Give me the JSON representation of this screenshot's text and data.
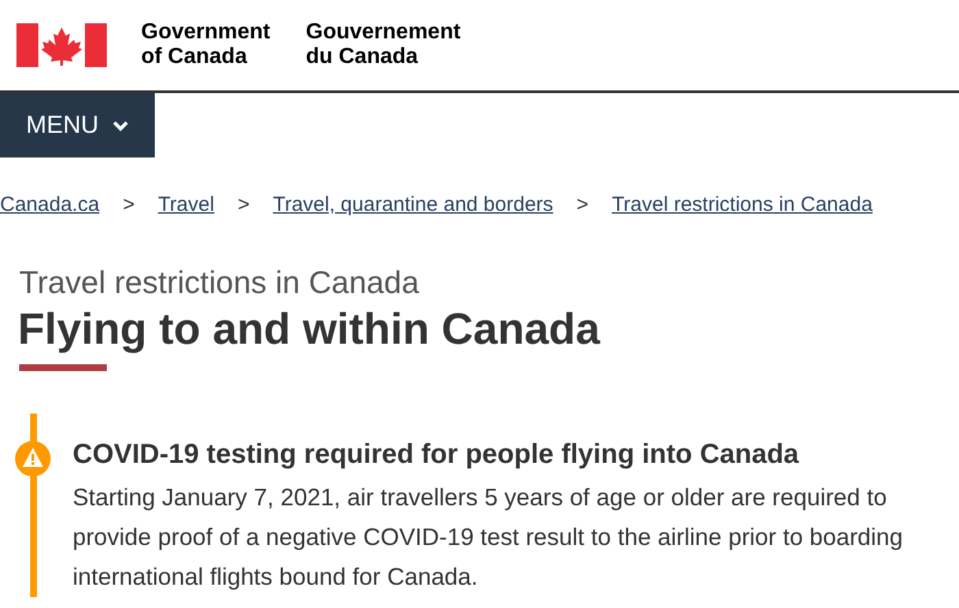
{
  "header": {
    "government_en": [
      "Government",
      "of Canada"
    ],
    "government_fr": [
      "Gouvernement",
      "du Canada"
    ]
  },
  "menu": {
    "label": "MENU"
  },
  "breadcrumbs": [
    {
      "label": "Canada.ca",
      "separator": ">"
    },
    {
      "label": "Travel",
      "separator": ">"
    },
    {
      "label": "Travel, quarantine and borders",
      "separator": ">"
    },
    {
      "label": "Travel restrictions in Canada"
    }
  ],
  "page": {
    "subtitle": "Travel restrictions in Canada",
    "title": "Flying to and within Canada"
  },
  "alert": {
    "kind": "warning",
    "heading": "COVID-19 testing required for people flying into Canada",
    "text": "Starting January 7, 2021, air travellers 5 years of age or older are required to provide proof of a negative COVID-19 test result to the airline prior to boarding international flights bound for Canada."
  }
}
